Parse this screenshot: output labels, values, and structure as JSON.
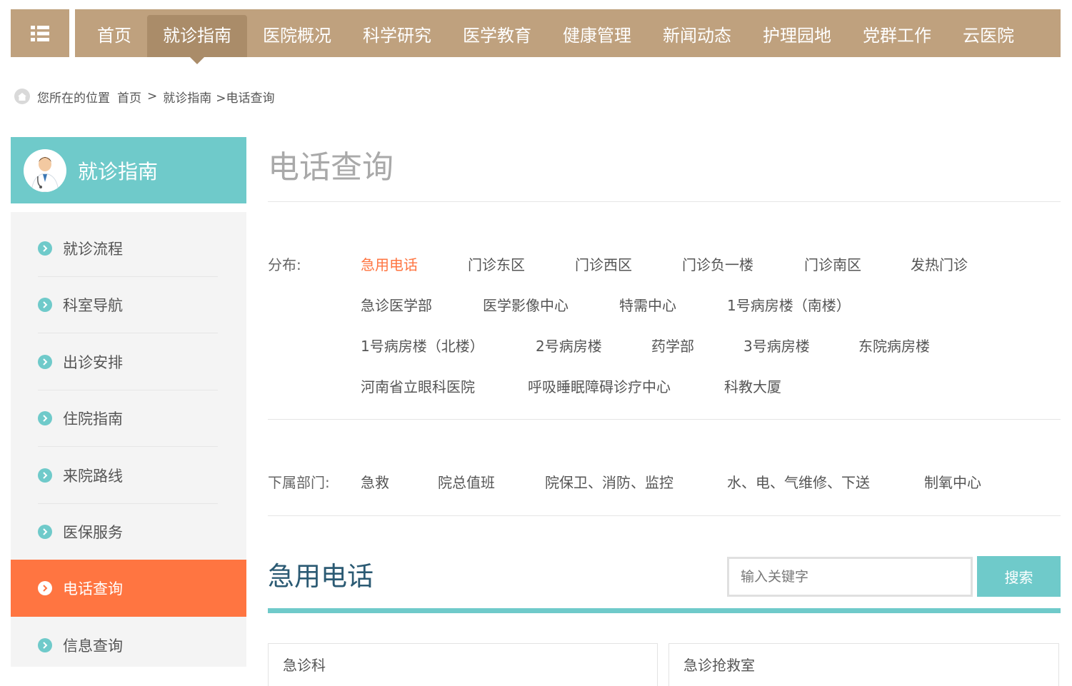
{
  "nav": {
    "menu_icon": "list-grid-icon",
    "items": [
      {
        "label": "首页"
      },
      {
        "label": "就诊指南",
        "active": true
      },
      {
        "label": "医院概况"
      },
      {
        "label": "科学研究"
      },
      {
        "label": "医学教育"
      },
      {
        "label": "健康管理"
      },
      {
        "label": "新闻动态"
      },
      {
        "label": "护理园地"
      },
      {
        "label": "党群工作"
      },
      {
        "label": "云医院"
      }
    ]
  },
  "breadcrumb": {
    "prefix": "您所在的位置",
    "home": "首页",
    "separator": ">",
    "section": "就诊指南",
    "current": ">电话查询"
  },
  "sidebar": {
    "title": "就诊指南",
    "items": [
      {
        "label": "就诊流程"
      },
      {
        "label": "科室导航"
      },
      {
        "label": "出诊安排"
      },
      {
        "label": "住院指南"
      },
      {
        "label": "来院路线"
      },
      {
        "label": "医保服务"
      },
      {
        "label": "电话查询",
        "active": true
      },
      {
        "label": "信息查询"
      }
    ]
  },
  "main": {
    "title": "电话查询",
    "distribution": {
      "label": "分布:",
      "items": [
        "急用电话",
        "门诊东区",
        "门诊西区",
        "门诊负一楼",
        "门诊南区",
        "发热门诊",
        "急诊医学部",
        "医学影像中心",
        "特需中心",
        "1号病房楼（南楼）",
        "1号病房楼（北楼）",
        "2号病房楼",
        "药学部",
        "3号病房楼",
        "东院病房楼",
        "河南省立眼科医院",
        "呼吸睡眠障碍诊疗中心",
        "科教大厦"
      ],
      "active_index": 0
    },
    "departments": {
      "label": "下属部门:",
      "items": [
        "急救",
        "院总值班",
        "院保卫、消防、监控",
        "水、电、气维修、下送",
        "制氧中心"
      ]
    },
    "section_title": "急用电话",
    "search": {
      "placeholder": "输入关键字",
      "value": "",
      "button_label": "搜索"
    },
    "cards": [
      {
        "title": "急诊科"
      },
      {
        "title": "急诊抢救室"
      }
    ]
  },
  "colors": {
    "nav_bg": "#bfa17e",
    "nav_active": "#aa8c69",
    "teal": "#6fcaca",
    "orange": "#ff7541",
    "title_blue": "#2b5a73"
  }
}
